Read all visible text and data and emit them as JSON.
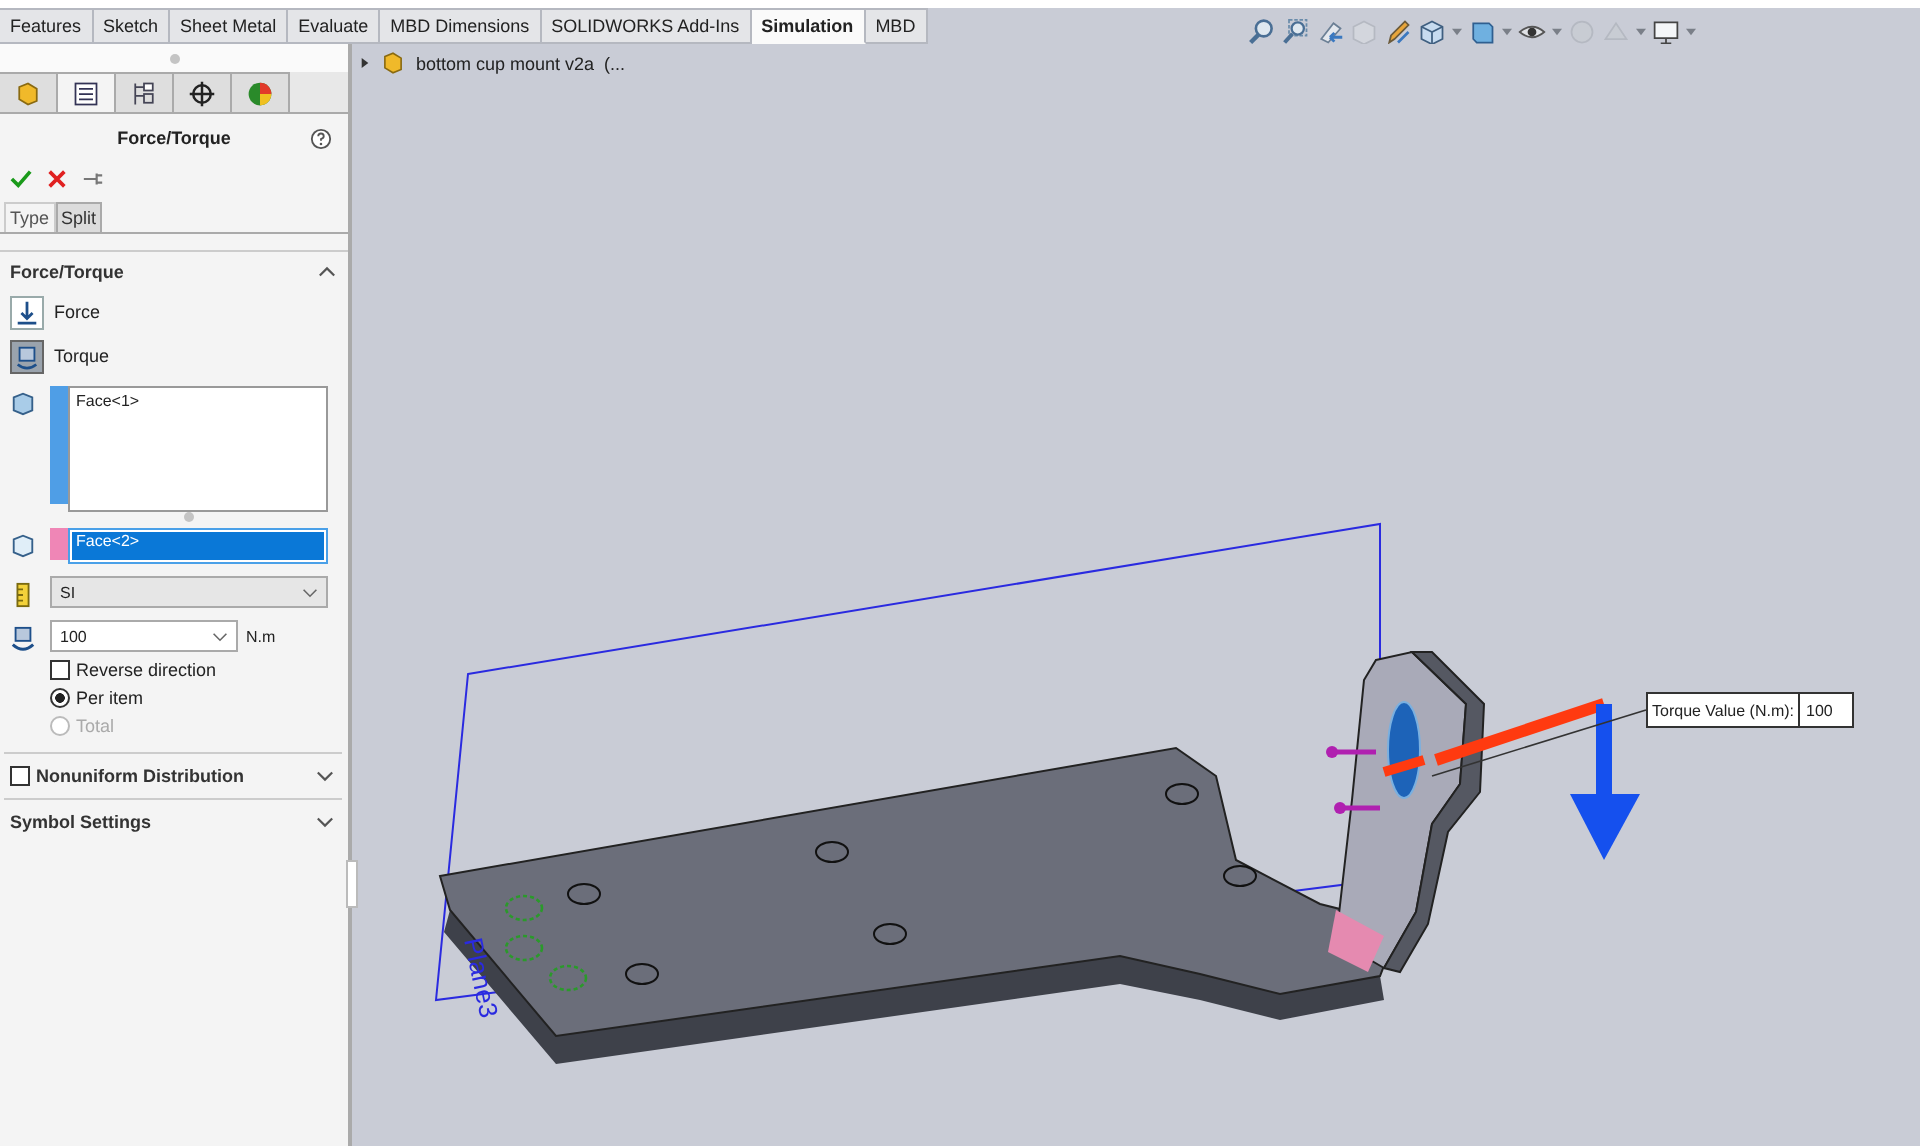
{
  "tabs": [
    {
      "label": "Features",
      "selected": false
    },
    {
      "label": "Sketch",
      "selected": false
    },
    {
      "label": "Sheet Metal",
      "selected": false
    },
    {
      "label": "Evaluate",
      "selected": false
    },
    {
      "label": "MBD Dimensions",
      "selected": false
    },
    {
      "label": "SOLIDWORKS Add-Ins",
      "selected": false
    },
    {
      "label": "Simulation",
      "selected": true
    },
    {
      "label": "MBD",
      "selected": false
    }
  ],
  "panel_tabs": [
    {
      "kind": "part",
      "selected": false
    },
    {
      "kind": "property",
      "selected": true
    },
    {
      "kind": "config",
      "selected": false
    },
    {
      "kind": "dimxpert",
      "selected": false
    },
    {
      "kind": "display",
      "selected": false
    }
  ],
  "property_manager": {
    "title": "Force/Torque",
    "subtabs": [
      {
        "label": "Type",
        "selected": true
      },
      {
        "label": "Split",
        "selected": false
      }
    ],
    "section": {
      "title": "Force/Torque",
      "expanded": true
    },
    "load_types": [
      {
        "kind": "force",
        "label": "Force",
        "selected": false
      },
      {
        "kind": "torque",
        "label": "Torque",
        "selected": true
      }
    ],
    "faces": [
      "Face<1>"
    ],
    "axis_face": "Face<2>",
    "units": "SI",
    "value": "100",
    "unit": "N.m",
    "reverse_direction": {
      "label": "Reverse direction",
      "checked": false
    },
    "distribution": [
      {
        "label": "Per item",
        "selected": true,
        "disabled": false
      },
      {
        "label": "Total",
        "selected": false,
        "disabled": true
      }
    ],
    "nonuniform": {
      "label": "Nonuniform Distribution",
      "checked": false,
      "expanded": false
    },
    "symbol_settings": {
      "label": "Symbol Settings",
      "expanded": false
    }
  },
  "tree": {
    "label": "bottom cup mount v2a  (...",
    "expanded": false
  },
  "viewport": {
    "plane_label": "Plane3",
    "callout": {
      "label": "Torque Value (N.m):",
      "value": "100"
    }
  }
}
